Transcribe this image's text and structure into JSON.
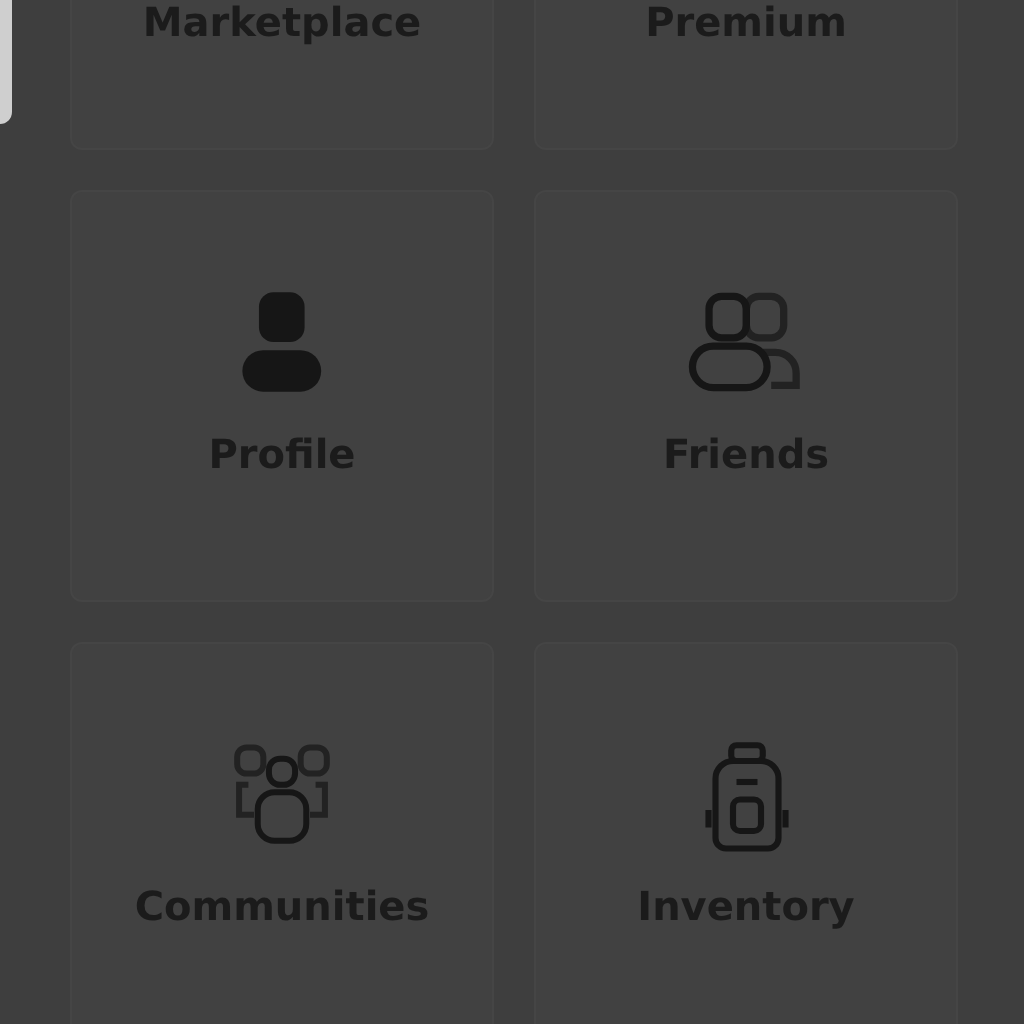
{
  "tiles": [
    {
      "label": "Marketplace",
      "kind": "cut"
    },
    {
      "label": "Premium",
      "kind": "cut"
    },
    {
      "label": "Profile",
      "kind": "profile"
    },
    {
      "label": "Friends",
      "kind": "friends"
    },
    {
      "label": "Communities",
      "kind": "communities"
    },
    {
      "label": "Inventory",
      "kind": "inventory"
    }
  ]
}
